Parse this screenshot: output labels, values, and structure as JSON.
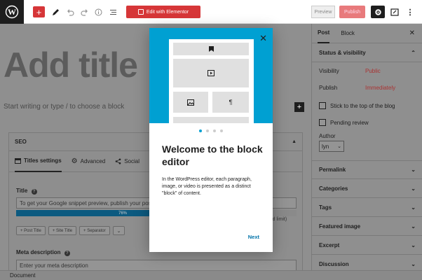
{
  "toolbar": {
    "elementor_label": "Edit with Elementor",
    "preview_label": "Preview",
    "publish_label": "Publish"
  },
  "editor": {
    "title_placeholder": "Add title",
    "paragraph_placeholder": "Start writing or type / to choose a block"
  },
  "seo": {
    "heading": "SEO",
    "tabs": [
      {
        "label": "Titles settings"
      },
      {
        "label": "Advanced"
      },
      {
        "label": "Social"
      }
    ],
    "title_label": "Title",
    "title_placeholder": "To get your Google snippet preview, publish your post!",
    "progress_percent": 76,
    "progress_label": "76%",
    "progress_note": "ended limit)",
    "tag_buttons": [
      "+ Post Title",
      "+ Site Title",
      "+ Separator"
    ],
    "meta_label": "Meta description",
    "meta_placeholder": "Enter your meta description"
  },
  "sidebar": {
    "tab_post": "Post",
    "tab_block": "Block",
    "status_title": "Status & visibility",
    "visibility_label": "Visibility",
    "visibility_value": "Public",
    "publish_label": "Publish",
    "publish_value": "Immediately",
    "stick_label": "Stick to the top of the blog",
    "pending_label": "Pending review",
    "author_label": "Author",
    "author_value": "lyn",
    "panels": [
      "Permalink",
      "Categories",
      "Tags",
      "Featured image",
      "Excerpt",
      "Discussion"
    ]
  },
  "footer": {
    "label": "Document"
  },
  "modal": {
    "title": "Welcome to the block editor",
    "body": "In the WordPress editor, each paragraph, image, or video is presented as a distinct \"block\" of content.",
    "next_label": "Next",
    "page_count": 4,
    "current_page": 1
  },
  "colors": {
    "accent": "#00a0d2",
    "publish": "#d63638",
    "link": "#0073aa"
  }
}
